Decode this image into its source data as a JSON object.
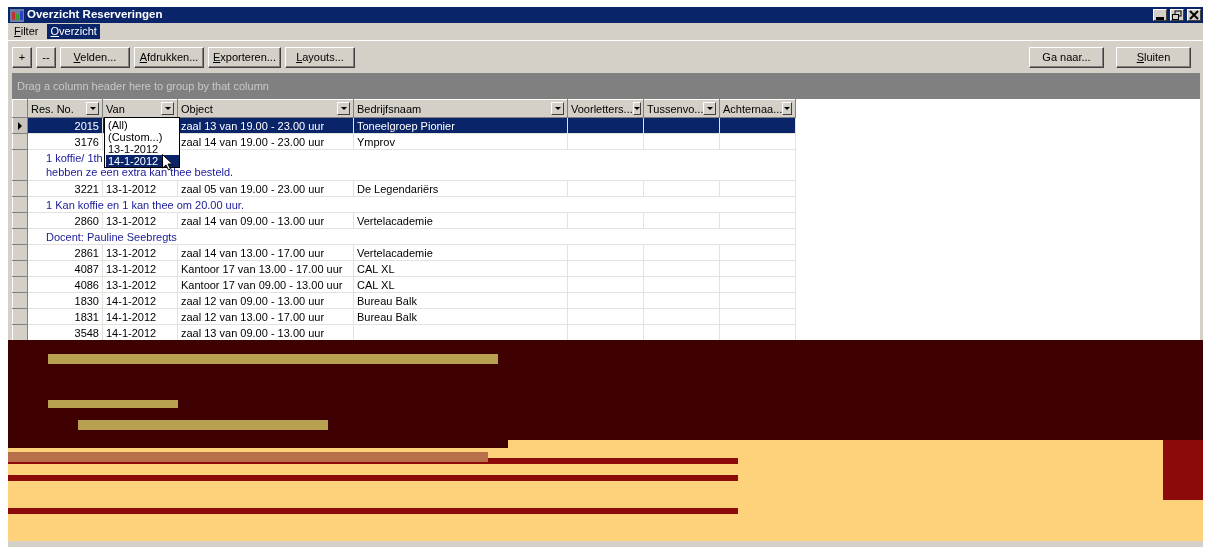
{
  "window": {
    "title": "Overzicht Reserveringen"
  },
  "menu": [
    {
      "label": "Filter",
      "selected": false,
      "underline_first": true
    },
    {
      "label": "Overzicht",
      "selected": true,
      "underline_first": true
    }
  ],
  "toolbar": {
    "left": [
      {
        "label": "+",
        "underline_first": false
      },
      {
        "label": "--",
        "underline_first": false
      },
      {
        "label": "Velden...",
        "underline_first": true
      },
      {
        "label": "Afdrukken...",
        "underline_first": true
      },
      {
        "label": "Exporteren...",
        "underline_first": true
      },
      {
        "label": "Layouts...",
        "underline_first": true
      }
    ],
    "right": [
      {
        "label": "Ga naar...",
        "underline_first": false
      },
      {
        "label": "Sluiten",
        "underline_first": true
      }
    ]
  },
  "group_hint": "Drag a column header here to group by that column",
  "table": {
    "columns": [
      "Res. No.",
      "Van",
      "Object",
      "Bedrijfsnaam",
      "Voorletters...",
      "Tussenvo...",
      "Achternaa..."
    ],
    "rows": [
      {
        "kind": "record",
        "selected": true,
        "res_no": "2015",
        "object": "zaal 13 van 19.00 - 23.00 uur",
        "bedrijfsnaam": "Toneelgroep Pionier"
      },
      {
        "kind": "record",
        "selected": false,
        "res_no": "3176",
        "object": "zaal 14 van 19.00 - 23.00 uur",
        "bedrijfsnaam": "Ymprov"
      },
      {
        "kind": "note",
        "lines": [
          "1 koffie/ 1th",
          "hebben ze een extra kan thee besteld."
        ]
      },
      {
        "kind": "record",
        "selected": false,
        "res_no": "3221",
        "van": "13-1-2012",
        "object": "zaal 05 van 19.00 - 23.00 uur",
        "bedrijfsnaam": "De Legendariërs"
      },
      {
        "kind": "note",
        "lines": [
          "1 Kan koffie en 1 kan thee om 20.00 uur."
        ]
      },
      {
        "kind": "record",
        "selected": false,
        "res_no": "2860",
        "van": "13-1-2012",
        "object": "zaal 14 van 09.00 - 13.00 uur",
        "bedrijfsnaam": "Vertelacademie"
      },
      {
        "kind": "note",
        "lines": [
          "Docent: Pauline Seebregts"
        ]
      },
      {
        "kind": "record",
        "selected": false,
        "res_no": "2861",
        "van": "13-1-2012",
        "object": "zaal 14 van 13.00 - 17.00 uur",
        "bedrijfsnaam": "Vertelacademie"
      },
      {
        "kind": "record",
        "selected": false,
        "res_no": "4087",
        "van": "13-1-2012",
        "object": "Kantoor 17 van 13.00 - 17.00 uur",
        "bedrijfsnaam": "CAL XL"
      },
      {
        "kind": "record",
        "selected": false,
        "res_no": "4086",
        "van": "13-1-2012",
        "object": "Kantoor 17 van 09.00 - 13.00 uur",
        "bedrijfsnaam": "CAL XL"
      },
      {
        "kind": "record",
        "selected": false,
        "res_no": "1830",
        "van": "14-1-2012",
        "object": "zaal 12 van 09.00 - 13.00 uur",
        "bedrijfsnaam": "Bureau Balk"
      },
      {
        "kind": "record",
        "selected": false,
        "res_no": "1831",
        "van": "14-1-2012",
        "object": "zaal 12 van 13.00 - 17.00 uur",
        "bedrijfsnaam": "Bureau Balk"
      },
      {
        "kind": "record",
        "selected": false,
        "res_no": "3548",
        "van": "14-1-2012",
        "object": "zaal 13 van 09.00 - 13.00 uur"
      }
    ]
  },
  "filter_dropdown": {
    "options": [
      {
        "label": "(All)",
        "selected": false
      },
      {
        "label": "(Custom...)",
        "selected": false
      },
      {
        "label": "13-1-2012",
        "selected": false
      },
      {
        "label": "14-1-2012",
        "selected": true
      }
    ]
  }
}
